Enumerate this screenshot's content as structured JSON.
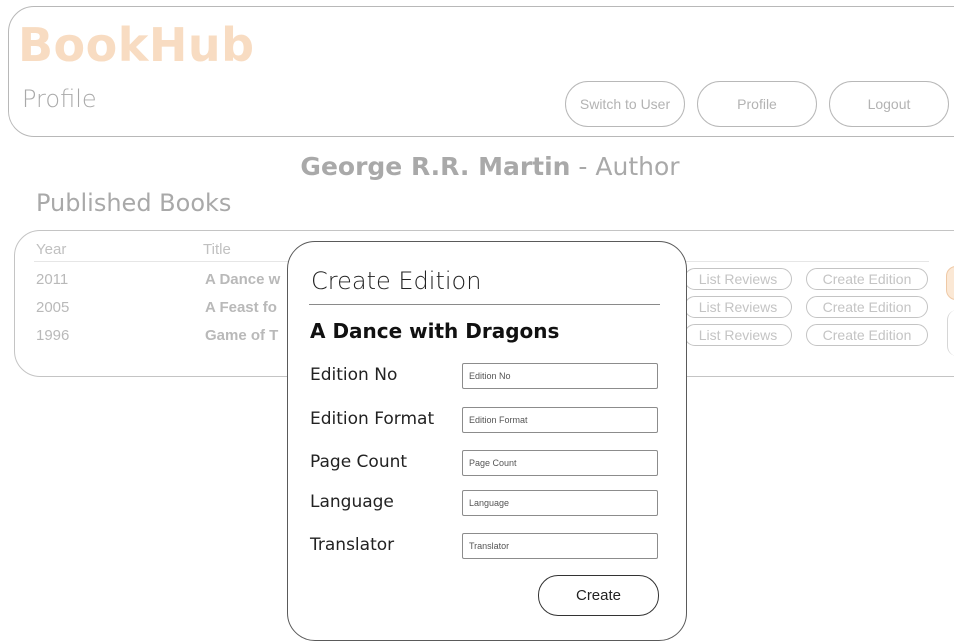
{
  "app": {
    "brand": "BookHub",
    "page_title": "Profile"
  },
  "header": {
    "buttons": {
      "switch": "Switch to User",
      "profile": "Profile",
      "logout": "Logout"
    }
  },
  "author": {
    "name": "George R.R. Martin",
    "role_suffix": " - Author"
  },
  "books_section": {
    "title": "Published Books",
    "columns": {
      "year": "Year",
      "title": "Title"
    },
    "rows": [
      {
        "year": "2011",
        "title": "A Dance w",
        "list_reviews": "List Reviews",
        "create_edition": "Create Edition"
      },
      {
        "year": "2005",
        "title": "A Feast fo",
        "list_reviews": "List Reviews",
        "create_edition": "Create Edition"
      },
      {
        "year": "1996",
        "title": "Game of T",
        "list_reviews": "List Reviews",
        "create_edition": "Create Edition"
      }
    ]
  },
  "modal": {
    "title": "Create Edition",
    "book_title": "A Dance with Dragons",
    "fields": [
      {
        "label": "Edition No",
        "placeholder": "Edition No",
        "value": ""
      },
      {
        "label": "Edition Format",
        "placeholder": "Edition Format",
        "value": ""
      },
      {
        "label": "Page Count",
        "placeholder": "Page Count",
        "value": ""
      },
      {
        "label": "Language",
        "placeholder": "Language",
        "value": ""
      },
      {
        "label": "Translator",
        "placeholder": "Translator",
        "value": ""
      }
    ],
    "submit_label": "Create"
  },
  "colors": {
    "brand": "#f8dcc2",
    "accent": "#fbe8d5"
  }
}
